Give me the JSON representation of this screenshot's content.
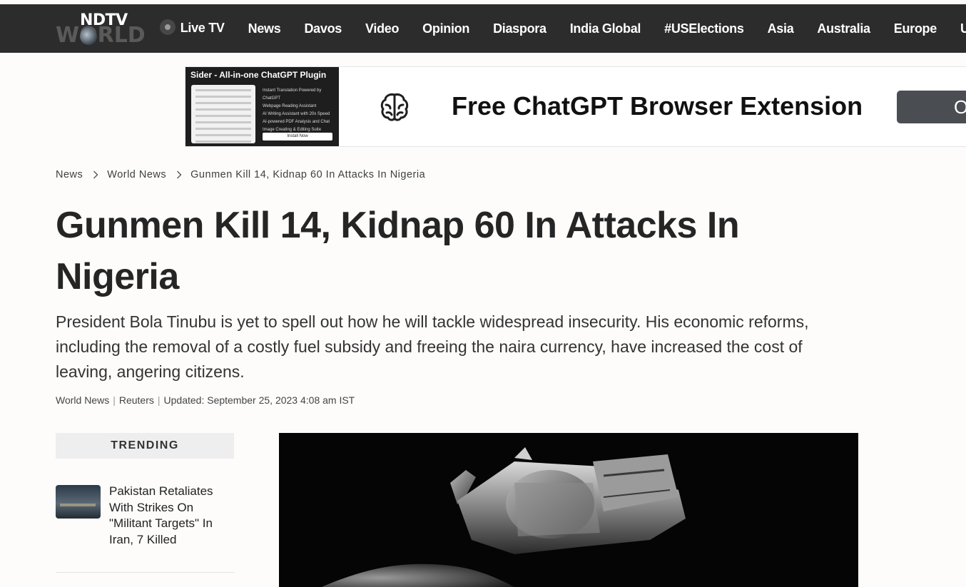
{
  "brand": {
    "logo_top": "NDTV",
    "logo_bottom": "WORLD"
  },
  "nav": {
    "items": [
      "Live TV",
      "News",
      "Davos",
      "Video",
      "Opinion",
      "Diaspora",
      "India Global",
      "#USElections",
      "Asia",
      "Australia",
      "Europe",
      "UK"
    ]
  },
  "ad": {
    "thumb_title": "Sider - All-in-one ChatGPT Plugin",
    "thumb_features": [
      "Instant Translation Powered by ChatGPT",
      "Webpage Reading Assistant",
      "AI Writing Assistant with 20x Speed",
      "AI-powered PDF Analysis and Chat",
      "Image Creating & Editing Suite"
    ],
    "thumb_install": "Install Now",
    "headline": "Free ChatGPT Browser Extension",
    "button_label": "O"
  },
  "breadcrumb": {
    "items": [
      "News",
      "World News",
      "Gunmen Kill 14, Kidnap 60 In Attacks In Nigeria"
    ]
  },
  "article": {
    "headline": "Gunmen Kill 14, Kidnap 60 In Attacks In Nigeria",
    "summary": "President Bola Tinubu is yet to spell out how he will tackle widespread insecurity. His economic reforms, including the removal of a costly fuel subsidy and freeing the naira currency, have increased the cost of leaving, angering citizens.",
    "meta": {
      "category": "World News",
      "source": "Reuters",
      "updated": "Updated: September 25, 2023 4:08 am IST"
    }
  },
  "trending": {
    "title": "TRENDING",
    "items": [
      {
        "title": "Pakistan Retaliates With Strikes On \"Militant Targets\" In Iran, 7 Killed"
      }
    ]
  }
}
